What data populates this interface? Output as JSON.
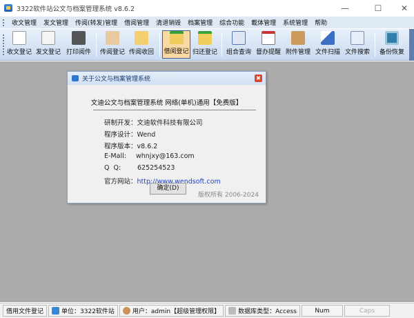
{
  "window": {
    "title": "3322软件站公文与档案管理系统 v8.6.2"
  },
  "menu": [
    "收文管理",
    "发文管理",
    "传阅(转发)管理",
    "借阅管理",
    "清退销毁",
    "档案管理",
    "综合功能",
    "載体管理",
    "系统管理",
    "帮助"
  ],
  "toolbar": [
    {
      "label": "收文登记",
      "icon": "pencil-document-icon"
    },
    {
      "label": "发文登记",
      "icon": "copy-edit-icon"
    },
    {
      "label": "打印阅件",
      "icon": "printer-icon"
    },
    {
      "label": "传阅登记",
      "icon": "hand-document-icon"
    },
    {
      "label": "传阅收回",
      "icon": "folder-icon"
    },
    {
      "label": "借阅登记",
      "icon": "folder-out-icon",
      "active": true
    },
    {
      "label": "归还登记",
      "icon": "folder-in-icon"
    },
    {
      "label": "组合查询",
      "icon": "window-query-icon"
    },
    {
      "label": "督办提醒",
      "icon": "calendar-icon"
    },
    {
      "label": "附件管理",
      "icon": "clipboard-icon"
    },
    {
      "label": "文件扫描",
      "icon": "scanner-icon"
    },
    {
      "label": "文件搜索",
      "icon": "search-window-icon"
    },
    {
      "label": "备份恢复",
      "icon": "floppy-icon"
    }
  ],
  "dialog": {
    "title": "关于公文与档案管理系统",
    "heading": "文迪公文与档案管理系统 网络(单机)通用【免费版】",
    "rows": [
      {
        "label": "研制开发：",
        "value": "文迪软件科技有限公司"
      },
      {
        "label": "程序设计：",
        "value": "Wend"
      },
      {
        "label": "程序版本：",
        "value": "v8.6.2"
      },
      {
        "label": "E-Mall:",
        "value": "whnjxy@163.com"
      },
      {
        "label": "Q  Q:",
        "value": "625254523"
      },
      {
        "label": "官方网站：",
        "value": "http://www.wendsoft.com"
      }
    ],
    "ok_label": "确定(D)",
    "copyright": "版权所有 2006-2024"
  },
  "status": {
    "doc": "借用文件登记",
    "unit": "单位：3322软件站",
    "user": "用户：admin【超级管理权限】",
    "db": "数据库类型：Access",
    "num": "Num",
    "caps": "Caps"
  }
}
